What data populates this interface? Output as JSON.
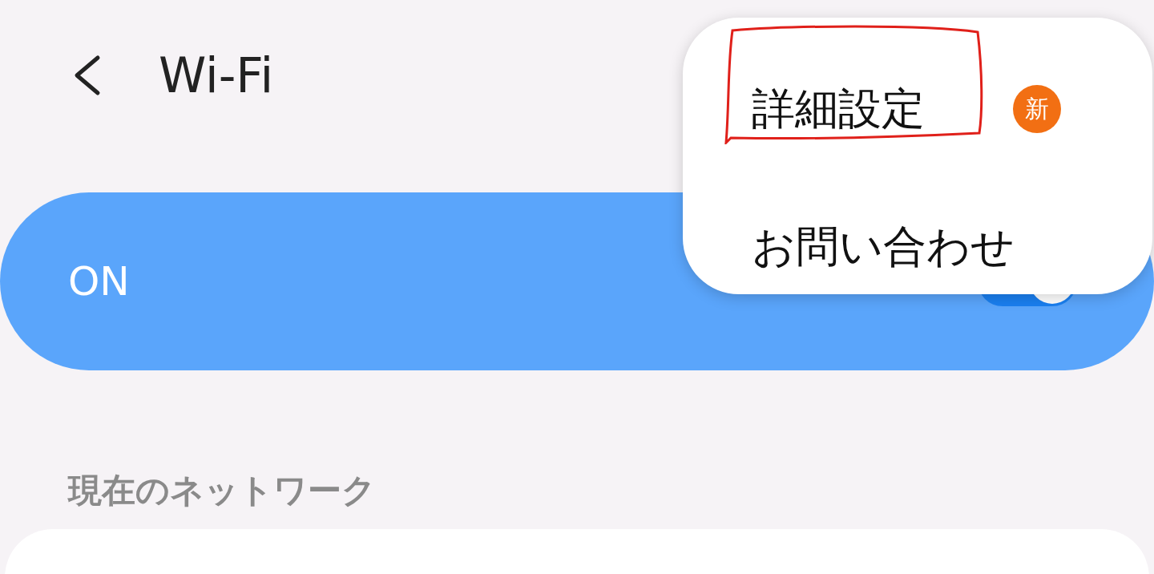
{
  "header": {
    "title": "Wi-Fi"
  },
  "master_switch": {
    "label": "ON",
    "on": true
  },
  "section": {
    "title": "現在のネットワーク"
  },
  "menu": {
    "items": [
      {
        "label": "詳細設定",
        "badge": "新",
        "annotated": true
      },
      {
        "label": "お問い合わせ",
        "annotated": false
      }
    ]
  }
}
